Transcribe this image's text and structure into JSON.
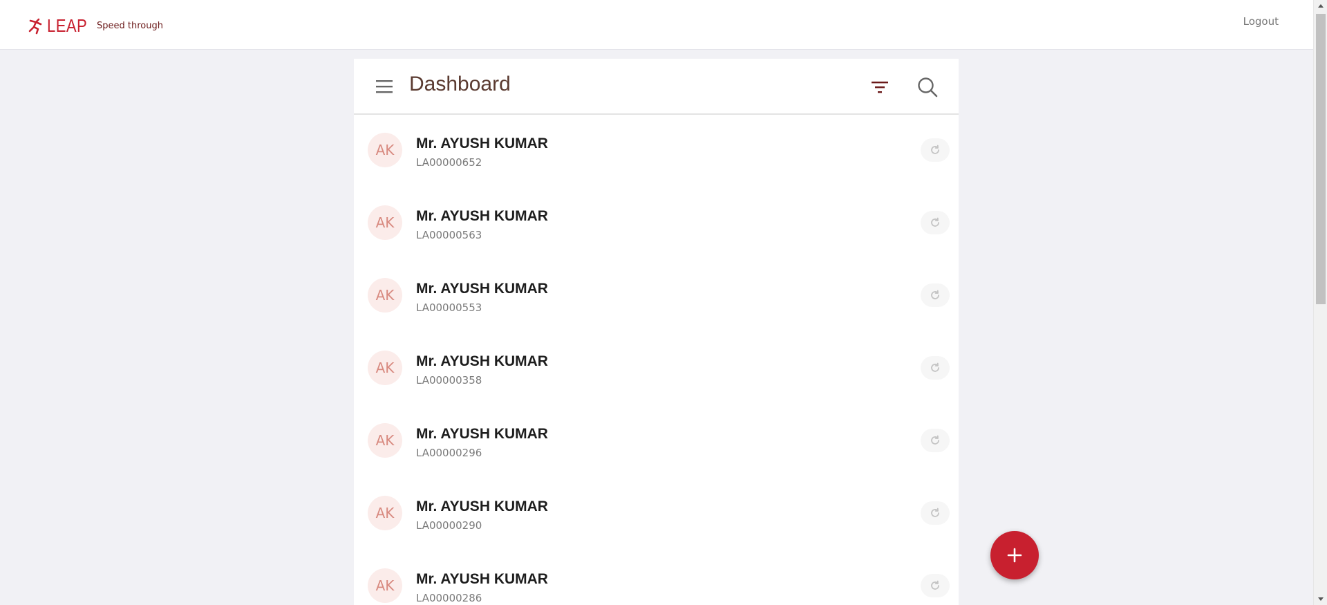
{
  "brand": {
    "name": "LEAP",
    "tagline": "Speed through",
    "icon": "runner-icon",
    "color": "#c8202f"
  },
  "header": {
    "logout_label": "Logout"
  },
  "panel": {
    "title": "Dashboard"
  },
  "list": {
    "items": [
      {
        "initials": "AK",
        "name": "Mr. AYUSH KUMAR",
        "id": "LA00000652"
      },
      {
        "initials": "AK",
        "name": "Mr. AYUSH KUMAR",
        "id": "LA00000563"
      },
      {
        "initials": "AK",
        "name": "Mr. AYUSH KUMAR",
        "id": "LA00000553"
      },
      {
        "initials": "AK",
        "name": "Mr. AYUSH KUMAR",
        "id": "LA00000358"
      },
      {
        "initials": "AK",
        "name": "Mr. AYUSH KUMAR",
        "id": "LA00000296"
      },
      {
        "initials": "AK",
        "name": "Mr. AYUSH KUMAR",
        "id": "LA00000290"
      },
      {
        "initials": "AK",
        "name": "Mr. AYUSH KUMAR",
        "id": "LA00000286"
      }
    ]
  },
  "icons": {
    "menu": "menu-icon",
    "filter": "filter-icon",
    "search": "search-icon",
    "refresh": "refresh-icon",
    "add": "plus-icon"
  }
}
